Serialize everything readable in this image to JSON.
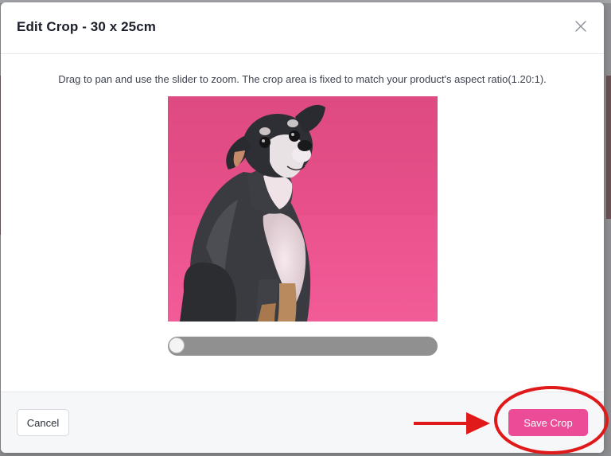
{
  "modal": {
    "title": "Edit Crop - 30 x 25cm",
    "close_icon": "close-icon",
    "instructions": "Drag to pan and use the slider to zoom. The crop area is fixed to match your product's aspect ratio(1.20:1).",
    "crop_image": {
      "description_icon": "dog-photo",
      "background_color": "#e54a86"
    },
    "zoom": {
      "value_fraction": 0.0
    },
    "footer": {
      "cancel_label": "Cancel",
      "save_label": "Save Crop"
    }
  },
  "colors": {
    "accent": "#ec4c97",
    "annotation": "#e01a1a"
  }
}
